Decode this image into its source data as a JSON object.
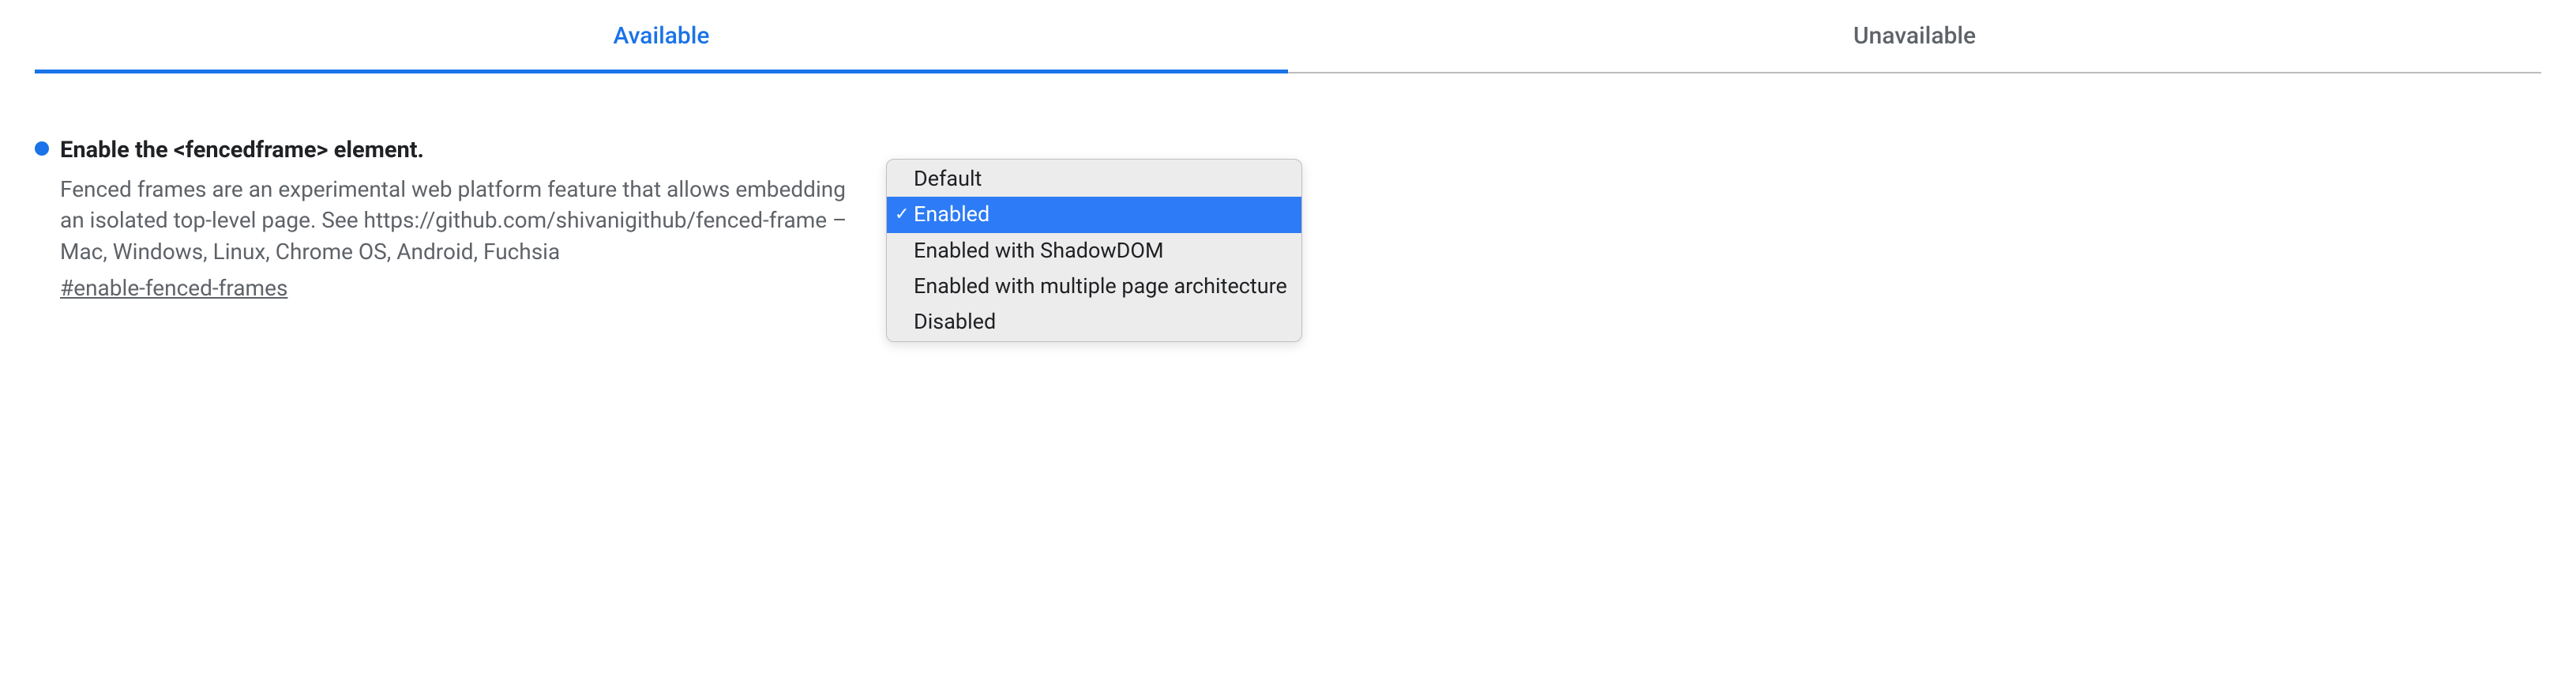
{
  "tabs": {
    "available": "Available",
    "unavailable": "Unavailable"
  },
  "flag": {
    "title": "Enable the <fencedframe> element.",
    "description": "Fenced frames are an experimental web platform feature that allows embedding an isolated top-level page. See https://github.com/shivanigithub/fenced-frame – Mac, Windows, Linux, Chrome OS, Android, Fuchsia",
    "hash": "#enable-fenced-frames"
  },
  "dropdown": {
    "options": {
      "0": "Default",
      "1": "Enabled",
      "2": "Enabled with ShadowDOM",
      "3": "Enabled with multiple page architecture",
      "4": "Disabled"
    },
    "selected_index": 1
  }
}
